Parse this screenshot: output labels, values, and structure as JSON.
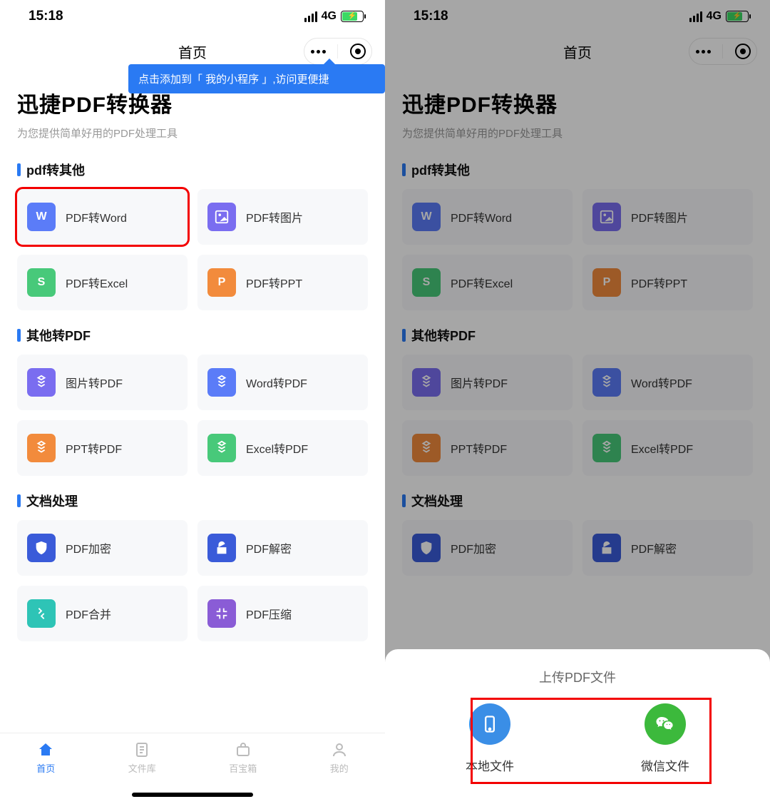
{
  "status": {
    "time": "15:18",
    "network": "4G"
  },
  "titlebar": {
    "title": "首页"
  },
  "header": {
    "title": "迅捷PDF转换器",
    "subtitle": "为您提供简单好用的PDF处理工具",
    "tip": "点击添加到「 我的小程序 」,访问更便捷"
  },
  "sections": {
    "pdf_to_other": {
      "title": "pdf转其他",
      "items": [
        "PDF转Word",
        "PDF转图片",
        "PDF转Excel",
        "PDF转PPT"
      ]
    },
    "other_to_pdf": {
      "title": "其他转PDF",
      "items": [
        "图片转PDF",
        "Word转PDF",
        "PPT转PDF",
        "Excel转PDF"
      ]
    },
    "doc_process": {
      "title": "文档处理",
      "items": [
        "PDF加密",
        "PDF解密",
        "PDF合并",
        "PDF压缩"
      ]
    }
  },
  "tabs": [
    "首页",
    "文件库",
    "百宝箱",
    "我的"
  ],
  "sheet": {
    "title": "上传PDF文件",
    "local": "本地文件",
    "wechat": "微信文件"
  }
}
